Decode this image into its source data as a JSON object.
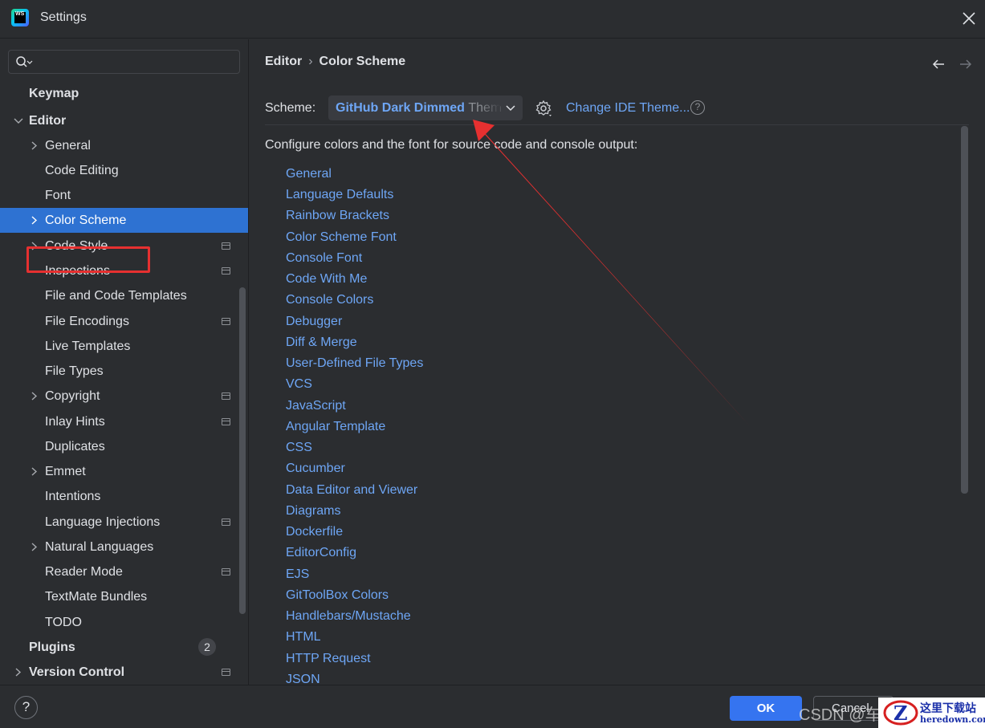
{
  "window": {
    "title": "Settings"
  },
  "search": {
    "placeholder": ""
  },
  "sidebar": {
    "items": [
      {
        "label": "Keymap"
      },
      {
        "label": "Editor"
      },
      {
        "label": "General"
      },
      {
        "label": "Code Editing"
      },
      {
        "label": "Font"
      },
      {
        "label": "Color Scheme"
      },
      {
        "label": "Code Style"
      },
      {
        "label": "Inspections"
      },
      {
        "label": "File and Code Templates"
      },
      {
        "label": "File Encodings"
      },
      {
        "label": "Live Templates"
      },
      {
        "label": "File Types"
      },
      {
        "label": "Copyright"
      },
      {
        "label": "Inlay Hints"
      },
      {
        "label": "Duplicates"
      },
      {
        "label": "Emmet"
      },
      {
        "label": "Intentions"
      },
      {
        "label": "Language Injections"
      },
      {
        "label": "Natural Languages"
      },
      {
        "label": "Reader Mode"
      },
      {
        "label": "TextMate Bundles"
      },
      {
        "label": "TODO"
      },
      {
        "label": "Plugins",
        "badge": "2"
      },
      {
        "label": "Version Control"
      }
    ]
  },
  "main": {
    "breadcrumb": [
      "Editor",
      "Color Scheme"
    ],
    "breadcrumb_separator": "›",
    "scheme_label": "Scheme:",
    "scheme_value": "GitHub Dark Dimmed",
    "scheme_value_suffix": "Them",
    "change_ide_theme": "Change IDE Theme...",
    "help_glyph": "?",
    "description": "Configure colors and the font for source code and console output:",
    "categories": [
      "General",
      "Language Defaults",
      "Rainbow Brackets",
      "Color Scheme Font",
      "Console Font",
      "Code With Me",
      "Console Colors",
      "Debugger",
      "Diff & Merge",
      "User-Defined File Types",
      "VCS",
      "JavaScript",
      "Angular Template",
      "CSS",
      "Cucumber",
      "Data Editor and Viewer",
      "Diagrams",
      "Dockerfile",
      "EditorConfig",
      "EJS",
      "GitToolBox Colors",
      "Handlebars/Mustache",
      "HTML",
      "HTTP Request",
      "JSON"
    ]
  },
  "footer": {
    "help_glyph": "?",
    "ok_label": "OK",
    "cancel_label": "Cancel",
    "csdn_watermark": "CSDN @车"
  },
  "watermark": {
    "line1": "这里下载站",
    "line2": "heredown.com"
  },
  "colors": {
    "accent": "#3574f0",
    "link": "#6ea6f5",
    "selection": "#2e72d2",
    "annotation": "#e63030"
  }
}
